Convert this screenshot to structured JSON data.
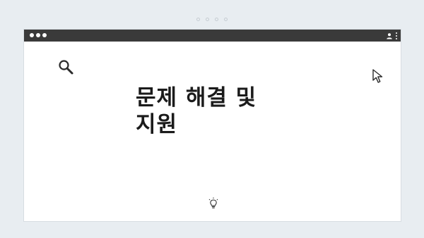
{
  "window": {
    "titlebar": {
      "controls": [
        "dot-icon",
        "dot-icon",
        "dot-icon"
      ],
      "right_icons": [
        "user-icon",
        "kebab-menu-icon"
      ]
    }
  },
  "pager": {
    "dots": 4,
    "icon": "page-dot-icon"
  },
  "slide": {
    "title_line1": "문제 해결 및",
    "title_line2": "지원",
    "icons": [
      "search-icon",
      "cursor-arrow-icon",
      "lightbulb-icon"
    ]
  },
  "colors": {
    "background": "#e8edf1",
    "titlebar": "#3a3a3a",
    "window": "#ffffff",
    "text": "#1b1b1b",
    "icon_stroke": "#2b2b2b"
  }
}
